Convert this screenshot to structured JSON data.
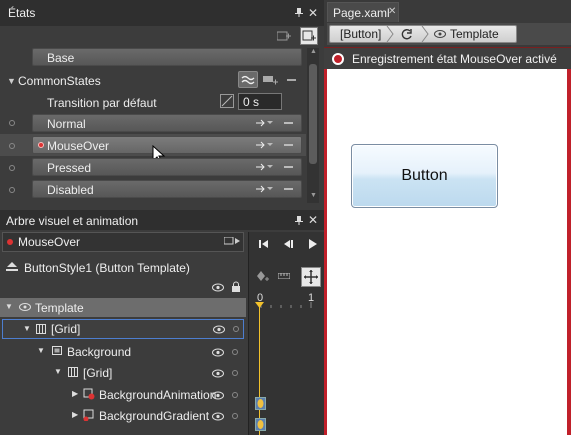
{
  "states_panel": {
    "title": "États",
    "base": "Base",
    "group": "CommonStates",
    "transition_label": "Transition par défaut",
    "transition_value": "0 s",
    "states": [
      "Normal",
      "MouseOver",
      "Pressed",
      "Disabled"
    ]
  },
  "tree_panel": {
    "title": "Arbre visuel et animation",
    "timeline_name": "MouseOver",
    "scope": "ButtonStyle1 (Button Template)",
    "ruler": [
      "0",
      "1"
    ],
    "nodes": [
      "Template",
      "[Grid]",
      "Background",
      "[Grid]",
      "BackgroundAnimation",
      "BackgroundGradient"
    ]
  },
  "document": {
    "tab": "Page.xaml",
    "breadcrumb": [
      "[Button]",
      "Template"
    ],
    "recording": "Enregistrement état MouseOver activé",
    "button_label": "Button"
  },
  "colors": {
    "panel_bg": "#3c3c3c",
    "record_red": "#c0202a",
    "selection_blue": "#4d7ecf",
    "timeline_marker": "#f3c22b"
  }
}
